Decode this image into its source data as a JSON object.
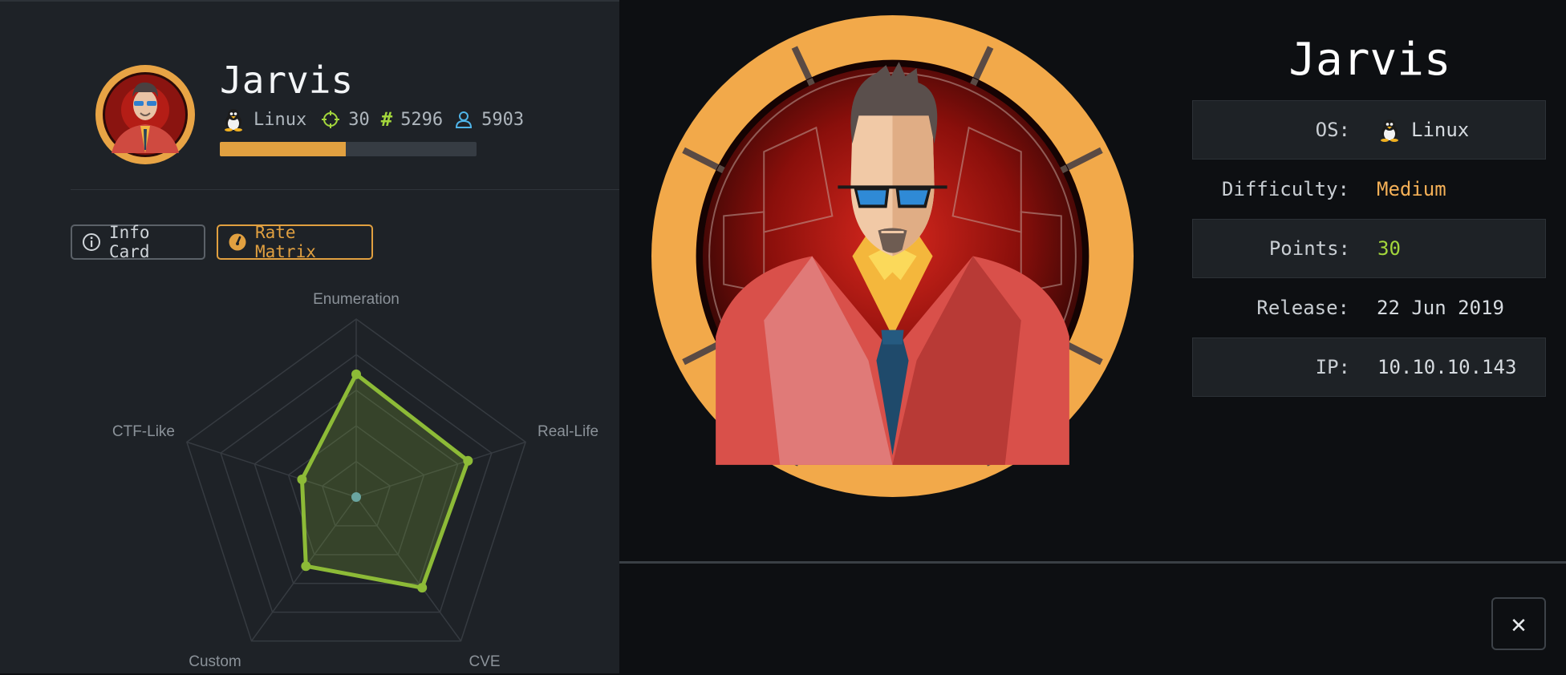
{
  "machine": {
    "name": "Jarvis",
    "os": "Linux",
    "points": "30",
    "owns": "5296",
    "users": "5903",
    "progress": 0.49
  },
  "buttons": {
    "info_card": "Info Card",
    "rate_matrix": "Rate Matrix"
  },
  "chart_data": {
    "type": "radar",
    "axes": [
      "Enumeration",
      "Real-Life",
      "CVE",
      "Custom",
      "CTF-Like"
    ],
    "values": [
      0.69,
      0.66,
      0.63,
      0.48,
      0.32
    ],
    "max": 1,
    "rings": 5,
    "series_color": "#8dbb37",
    "center_color": "#6aa5a0"
  },
  "details": {
    "title": "Jarvis",
    "rows": [
      {
        "label": "OS:",
        "value": "Linux"
      },
      {
        "label": "Difficulty:",
        "value": "Medium",
        "color": "#f4b057"
      },
      {
        "label": "Points:",
        "value": "30",
        "color": "#a3d63c"
      },
      {
        "label": "Release:",
        "value": "22 Jun 2019"
      },
      {
        "label": "IP:",
        "value": "10.10.10.143"
      }
    ]
  },
  "close_label": "✕",
  "colors": {
    "accent": "#e1a040",
    "green": "#8dbb37",
    "panel": "#1e2227",
    "background": "#0d0f12"
  }
}
